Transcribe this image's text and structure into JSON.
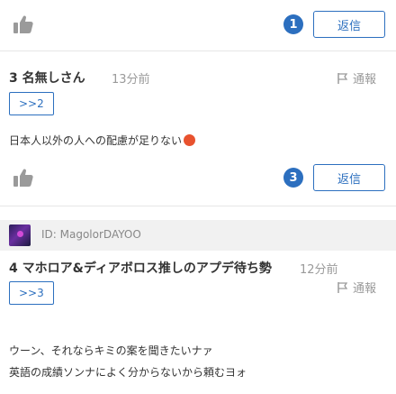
{
  "post1": {
    "reply_count": "1",
    "reply_label": "返信"
  },
  "post3": {
    "number_name": "3 名無しさん",
    "time": "13分前",
    "report_label": "通報",
    "anchor": ">>2",
    "body": "日本人以外の人への配慮が足りない",
    "reply_count": "3",
    "reply_label": "返信"
  },
  "post4": {
    "user_id": "ID: MagolorDAYOO",
    "number_name": "4 マホロア&ディアボロス推しのアプデ待ち勢",
    "time": "12分前",
    "report_label": "通報",
    "anchor": ">>3",
    "body_lines": [
      "ウーン、それならキミの案を聞きたいナァ",
      "英語の成績ソンナによく分からないから頼むヨォ"
    ]
  },
  "icons": {
    "like": "thumbs-up-icon",
    "report": "flag-icon",
    "emoji": "angry-face-icon"
  },
  "colors": {
    "accent": "#2c6fbf",
    "muted": "#9a9a9a",
    "text": "#333333",
    "id_bar": "#f1f1f1"
  }
}
